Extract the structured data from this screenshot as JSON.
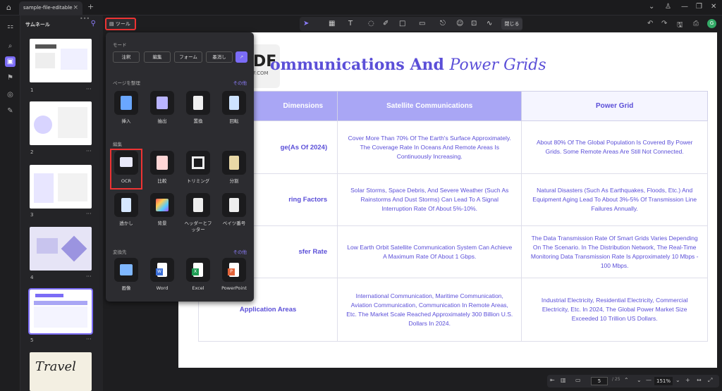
{
  "tab": {
    "title": "sample-file-editable"
  },
  "sidebar": {
    "title": "サムネール"
  },
  "thumbnails": [
    {
      "n": "1"
    },
    {
      "n": "2"
    },
    {
      "n": "3"
    },
    {
      "n": "4"
    },
    {
      "n": "5"
    }
  ],
  "tools_button": "ツール",
  "toolbar": {
    "close": "閉じる"
  },
  "popup": {
    "mode_label": "モード",
    "modes": [
      "注釈",
      "編集",
      "フォーム",
      "墨消し"
    ],
    "organize_label": "ページを整理",
    "organize_more": "その他",
    "organize": [
      "挿入",
      "抽出",
      "置換",
      "回転"
    ],
    "edit_label": "編集",
    "edit_tools": [
      "OCR",
      "比較",
      "トリミング",
      "分割",
      "透かし",
      "背景",
      "ヘッダーとフッター",
      "ベイツ番号"
    ],
    "convert_label": "変換先",
    "convert_more": "その他",
    "convert": [
      "画像",
      "Word",
      "Excel",
      "PowerPoint"
    ]
  },
  "document": {
    "title_bold": "ommunications And",
    "title_italic": "Power Grids",
    "logo_text": "DF",
    "logo_sub": "F.COM",
    "headers": [
      "Dimensions",
      "Satellite Communications",
      "Power Grid"
    ],
    "rows": [
      {
        "label": "ge(As Of 2024)",
        "sat": "Cover More Than 70% Of The Earth's Surface Approximately. The Coverage Rate In Oceans And Remote Areas Is Continuously Increasing.",
        "grid": "About 80% Of The Global Population Is Covered By Power Grids. Some Remote Areas Are Still Not Connected."
      },
      {
        "label": "ring Factors",
        "sat": "Solar Storms, Space Debris, And Severe Weather (Such As Rainstorms And Dust Storms) Can Lead To A Signal Interruption Rate Of About 5%-10%.",
        "grid": "Natural Disasters (Such As Earthquakes, Floods, Etc.) And Equipment Aging Lead To About 3%-5% Of Transmission Line Failures Annually."
      },
      {
        "label": "sfer Rate",
        "sat": "Low Earth Orbit Satellite Communication System Can Achieve A Maximum Rate Of About 1 Gbps.",
        "grid": "The Data Transmission Rate Of Smart Grids Varies Depending On The Scenario. In The Distribution Network, The Real-Time Monitoring Data Transmission Rate Is Approximately 10 Mbps - 100 Mbps."
      },
      {
        "label": "Application Areas",
        "sat": "International Communication, Maritime Communication, Aviation Communication, Communication In Remote Areas, Etc. The Market Scale Reached Approximately 300 Billion U.S. Dollars In 2024.",
        "grid": "Industrial Electricity, Residential Electricity, Commercial Electricity, Etc. In 2024, The Global Power Market Size Exceeded 10 Trillion US Dollars."
      }
    ]
  },
  "pager": {
    "current": "5",
    "total": "/ 25",
    "zoom": "151%"
  },
  "colors": {
    "accent": "#7b6cf6",
    "highlight": "#e33333"
  }
}
